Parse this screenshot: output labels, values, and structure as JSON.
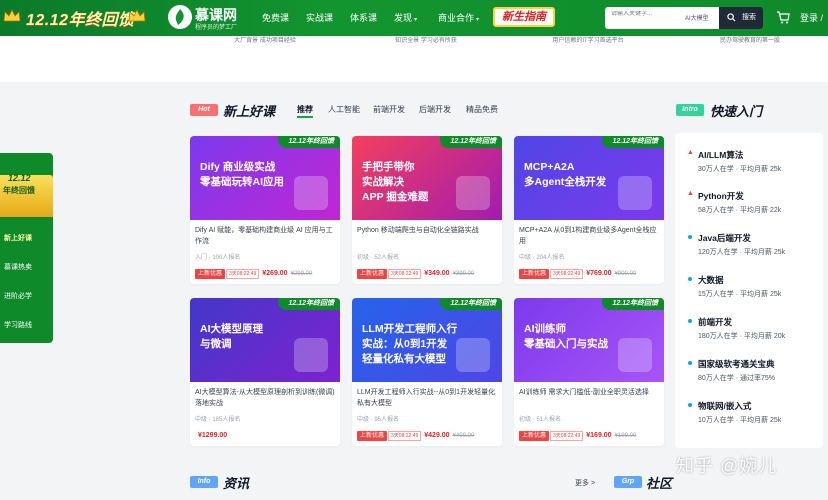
{
  "header": {
    "promo": "12.12年终回馈",
    "logo_main": "慕课网",
    "logo_sub": "程序员的梦工厂",
    "nav": [
      "免费课",
      "实战课",
      "体系课",
      "发现",
      "商业合作"
    ],
    "new_student": "新生指南",
    "search_placeholder": "请输入关键字...",
    "search_chip": "AI大模型",
    "search_button": "搜索",
    "login": "登录 / 注"
  },
  "strip": [
    "大厂背景 成功项目经验",
    "知识全景 学习必有所获",
    "用户信赖的IT学习首选平台",
    "民办驾驶教育的第一股"
  ],
  "new_courses": {
    "badge": "Hot",
    "title": "新上好课",
    "tabs": [
      "推荐",
      "人工智能",
      "前端开发",
      "后端开发",
      "精品免费"
    ],
    "courses": [
      {
        "ribbon": "12.12年终回馈",
        "cover": "Dify 商业级实战\n零基础玩转AI应用",
        "desc": "Dify AI 赋能，零基础构建商业级 AI 应用与工作流",
        "meta": "入门 · 100人报名",
        "tag": "上新优惠",
        "date": "3天08:22:49",
        "price": "¥269.00",
        "orig": "¥299.00",
        "bg1": "#7c3aed",
        "bg2": "#c026d3"
      },
      {
        "ribbon": "12.12年终回馈",
        "cover": "手把手带你\n实战解决\nAPP 掘金难题",
        "desc": "Python 移动端爬虫与自动化全链路实战",
        "meta": "初级 · 52人报名",
        "tag": "上新优惠",
        "date": "3天08:22:49",
        "price": "¥349.00",
        "orig": "¥399.00",
        "bg1": "#f43f5e",
        "bg2": "#a21caf"
      },
      {
        "ribbon": "12.12年终回馈",
        "cover": "MCP+A2A\n多Agent全栈开发",
        "desc": "MCP+A2A 从0到1构建商业级多Agent全栈应用",
        "meta": "中级 · 204人报名",
        "tag": "上新优惠",
        "date": "3天08:22:49",
        "price": "¥769.00",
        "orig": "¥900.00",
        "bg1": "#4f46e5",
        "bg2": "#7c3aed"
      },
      {
        "ribbon": "12.12年终回馈",
        "cover": "AI大模型原理\n与微调",
        "desc": "AI大模型算法-从大模型原理剖析到训练(微调)落地实战",
        "meta": "中级 · 185人报名",
        "tag": "",
        "date": "",
        "price": "¥1299.00",
        "orig": "",
        "bg1": "#4338ca",
        "bg2": "#7e22ce"
      },
      {
        "ribbon": "12.12年终回馈",
        "cover": "LLM开发工程师入行\n实战：从0到1开发\n轻量化私有大模型",
        "desc": "LLM开发工程师入行实战--从0到1开发轻量化私有大模型",
        "meta": "中级 · 95人报名",
        "tag": "上新优惠",
        "date": "3天08:22:49",
        "price": "¥429.00",
        "orig": "¥499.00",
        "bg1": "#2563eb",
        "bg2": "#4f46e5"
      },
      {
        "ribbon": "12.12年终回馈",
        "cover": "AI训练师\n零基础入门与实战",
        "desc": "AI训练师 需求大门槛低-副业全职灵活选择",
        "meta": "初级 · 51人报名",
        "tag": "上新优惠",
        "date": "3天08:22:49",
        "price": "¥169.00",
        "orig": "¥199.00",
        "bg1": "#7c3aed",
        "bg2": "#a855f7"
      }
    ]
  },
  "quick": {
    "badge": "Intro",
    "title": "快速入门",
    "items": [
      {
        "name": "AI/LLM算法",
        "meta": "30万人在学 · 平均月薪 25k",
        "hot": true
      },
      {
        "name": "Python开发",
        "meta": "58万人在学 · 平均月薪 22k",
        "hot": true
      },
      {
        "name": "Java后端开发",
        "meta": "120万人在学 · 平均月薪 25k",
        "hot": false
      },
      {
        "name": "大数据",
        "meta": "15万人在学 · 平均月薪 25k",
        "hot": false
      },
      {
        "name": "前端开发",
        "meta": "180万人在学 · 平均月薪 20k",
        "hot": false
      },
      {
        "name": "国家级软考通关宝典",
        "meta": "80万人在学 · 通过率75%",
        "hot": false
      },
      {
        "name": "物联网/嵌入式",
        "meta": "10万人在学 · 平均月薪 25k",
        "hot": false
      }
    ]
  },
  "float": {
    "year": "12.12",
    "word": "年终回馈",
    "items": [
      "新上好课",
      "慕课热卖",
      "进阶必学",
      "学习路线"
    ]
  },
  "news": {
    "badge": "Info",
    "title": "资讯",
    "more": "更多 >"
  },
  "community": {
    "badge": "Grp",
    "title": "社区"
  },
  "watermark": "知乎 @婉儿",
  "colors": {
    "brand": "#0f8a2b",
    "accent_red": "#ef4444",
    "hot_badge": "#f87171",
    "intro_badge": "#34d399",
    "info_badge": "#60a5fa"
  }
}
